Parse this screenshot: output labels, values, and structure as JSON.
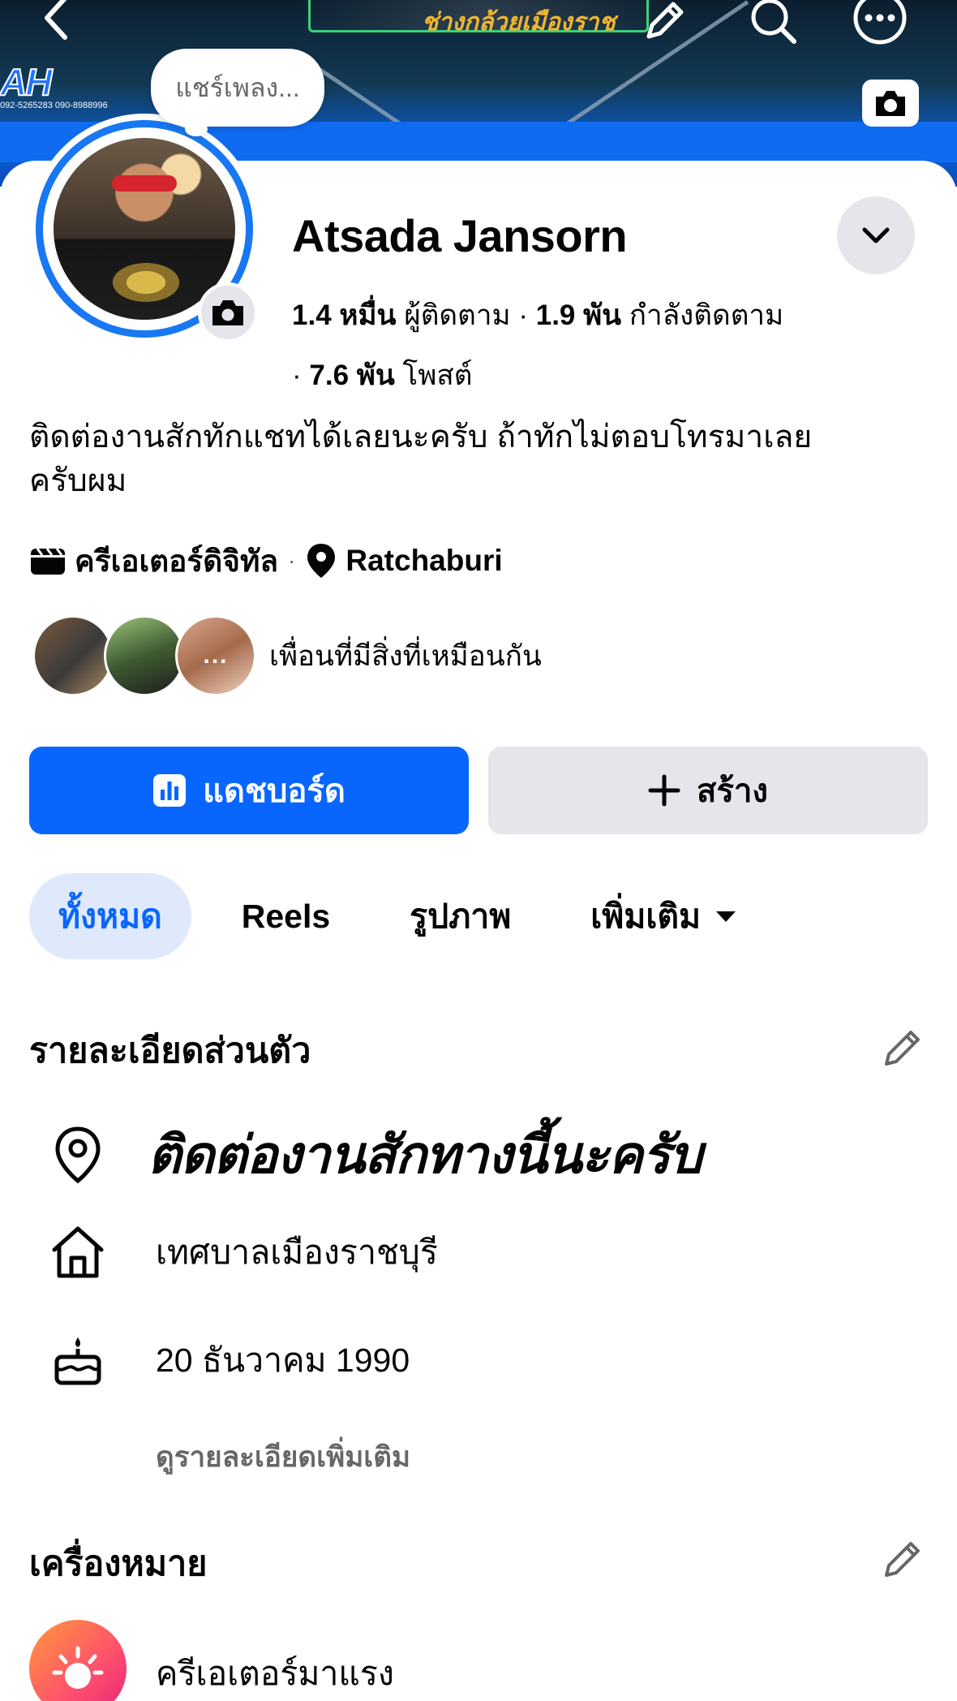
{
  "cover": {
    "shop_text": "ช่างกล้วยเมืองราช",
    "logo_text": "AH",
    "phone_text": "092-5265283 090-8988996"
  },
  "top_bar": {
    "back_icon": "chevron-left-icon",
    "edit_icon": "pencil-icon",
    "search_icon": "search-icon",
    "more_icon": "more-horizontal-icon"
  },
  "music_bubble": {
    "label": "แชร์เพลง..."
  },
  "profile": {
    "name": "Atsada Jansorn",
    "followers_value": "1.4 หมื่น",
    "followers_label": "ผู้ติดตาม",
    "following_value": "1.9 พัน",
    "following_label": "กำลังติดตาม",
    "posts_value": "7.6 พัน",
    "posts_label": "โพสต์",
    "bio_line1": "ติดต่องานสักทักแชทได้เลยนะครับ ถ้าทักไม่ตอบโทรมาเลย",
    "bio_line2": "ครับผม",
    "category": "ครีเอเตอร์ดิจิทัล",
    "location": "Ratchaburi",
    "mutual_text": "เพื่อนที่มีสิ่งที่เหมือนกัน",
    "mutual_more": "..."
  },
  "actions": {
    "dashboard_label": "แดชบอร์ด",
    "create_label": "สร้าง"
  },
  "tabs": [
    {
      "label": "ทั้งหมด",
      "active": true
    },
    {
      "label": "Reels",
      "active": false
    },
    {
      "label": "รูปภาพ",
      "active": false
    },
    {
      "label": "เพิ่มเติม",
      "active": false
    }
  ],
  "details": {
    "title": "รายละเอียดส่วนตัว",
    "contact": "ติดต่องานสักทางนี้นะครับ",
    "hometown": "เทศบาลเมืองราชบุรี",
    "birthday": "20 ธันวาคม  1990",
    "see_more": "ดูรายละเอียดเพิ่มเติม"
  },
  "badges": {
    "title": "เครื่องหมาย",
    "item_label": "ครีเอเตอร์มาแรง"
  },
  "colors": {
    "accent": "#0866ff",
    "ring": "#1877f2",
    "secondary_button": "#e4e6eb",
    "active_tab_bg": "#dfe9fb",
    "muted_text": "#65676b"
  }
}
